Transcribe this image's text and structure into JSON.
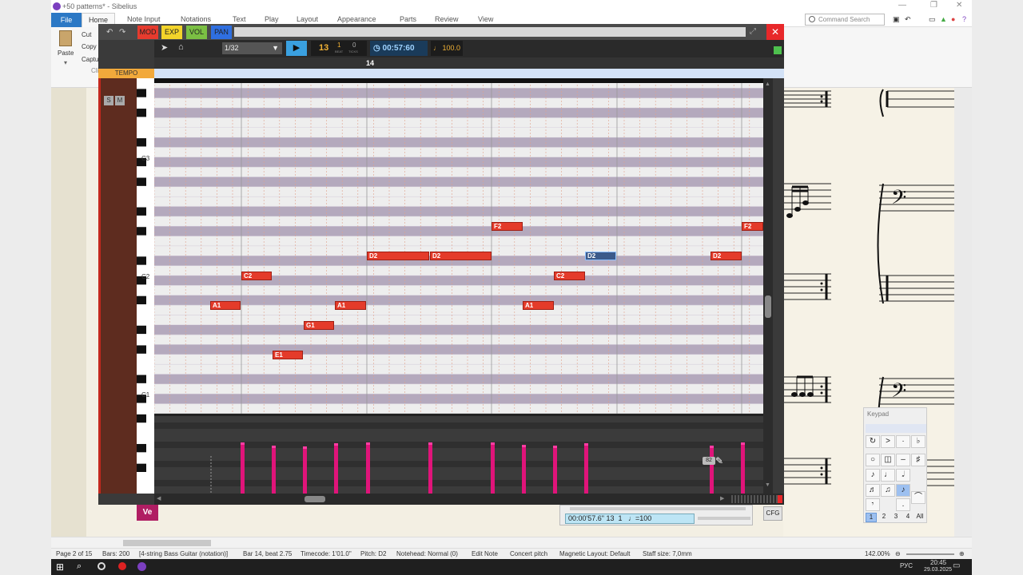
{
  "window": {
    "title": "+50 patterns* - Sibelius"
  },
  "ribbon_tabs": [
    "File",
    "Home",
    "Note Input",
    "Notations",
    "Text",
    "Play",
    "Layout",
    "Appearance",
    "Parts",
    "Review",
    "View"
  ],
  "command_search": {
    "placeholder": "Command Search"
  },
  "home": {
    "paste_label": "Paste",
    "items": [
      "Cut",
      "Copy",
      "Capture",
      "Clip"
    ]
  },
  "pianoroll": {
    "tabs": [
      "MOD",
      "EXP",
      "VOL",
      "PAN"
    ],
    "tab_colors": [
      "#e63b2e",
      "#f3d42a",
      "#7bc043",
      "#2f6fe0"
    ],
    "quantize": "1/32",
    "position": {
      "bar": "13",
      "beat": "1",
      "ticks": "0",
      "beat_label": "BEAT",
      "ticks_label": "TICKS"
    },
    "timecode": "00:57:60",
    "tempo": "100.0",
    "tempo_label": "TEMPO",
    "bar_marker": "14",
    "solo": "S",
    "mute": "M",
    "keyboard_labels": [
      "C3",
      "C2",
      "C1"
    ],
    "notes": [
      {
        "pitch": "A1",
        "selected": false
      },
      {
        "pitch": "C2",
        "selected": false
      },
      {
        "pitch": "E1",
        "selected": false
      },
      {
        "pitch": "G1",
        "selected": false
      },
      {
        "pitch": "A1",
        "selected": false
      },
      {
        "pitch": "D2",
        "selected": false
      },
      {
        "pitch": "D2",
        "selected": false
      },
      {
        "pitch": "F2",
        "selected": false
      },
      {
        "pitch": "A1",
        "selected": false
      },
      {
        "pitch": "C2",
        "selected": false
      },
      {
        "pitch": "D2",
        "selected": true
      },
      {
        "pitch": "D2",
        "selected": false
      },
      {
        "pitch": "F2",
        "selected": false
      }
    ],
    "velocity_tooltip": "82",
    "velocity_label": "Ve",
    "cfg_label": "CFG",
    "bottom_readout": "00:00'57.6\" 13  1   ♩=100"
  },
  "keypad": {
    "title": "Keypad",
    "layouts": [
      "1",
      "2",
      "3",
      "4",
      "All"
    ]
  },
  "status": {
    "page": "Page 2 of 15",
    "bars": "Bars: 200",
    "instrument": "[4-string Bass Guitar (notation)]",
    "position": "Bar 14, beat 2.75",
    "timecode": "Timecode: 1'01.0\"",
    "pitch": "Pitch: D2",
    "notehead": "Notehead: Normal (0)",
    "mode": "Edit Note",
    "concert": "Concert pitch",
    "magnetic": "Magnetic Layout: Default",
    "staff": "Staff size: 7,0mm",
    "zoom": "142.00%"
  },
  "clock": {
    "time": "20:45",
    "date": "29.03.2025",
    "lang": "РУС"
  }
}
